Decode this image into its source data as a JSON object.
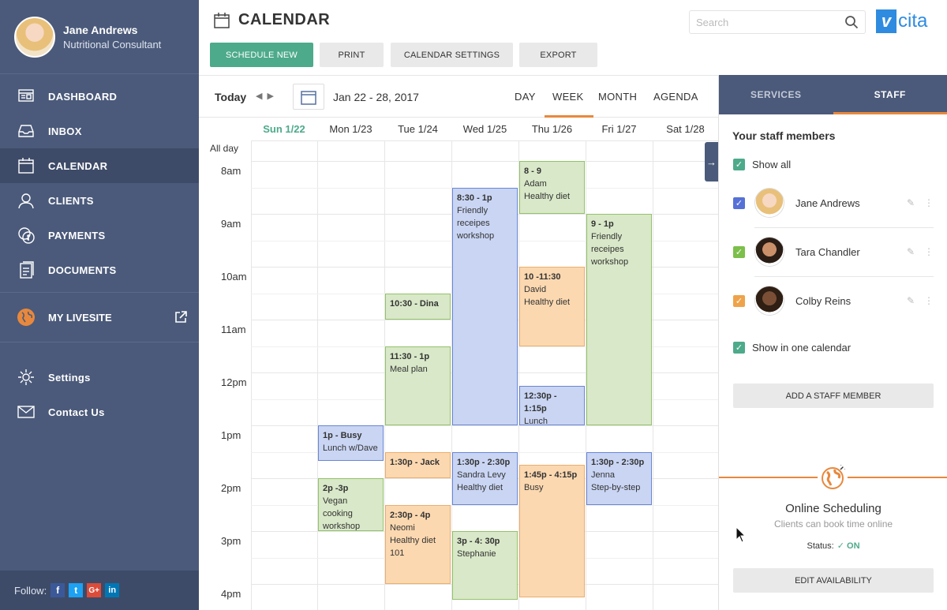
{
  "profile": {
    "name": "Jane Andrews",
    "role": "Nutritional Consultant"
  },
  "nav": [
    {
      "label": "DASHBOARD",
      "icon": "dashboard-icon"
    },
    {
      "label": "INBOX",
      "icon": "inbox-icon"
    },
    {
      "label": "CALENDAR",
      "icon": "calendar-icon",
      "active": true
    },
    {
      "label": "CLIENTS",
      "icon": "clients-icon"
    },
    {
      "label": "PAYMENTS",
      "icon": "payments-icon"
    },
    {
      "label": "DOCUMENTS",
      "icon": "documents-icon"
    }
  ],
  "livesite": {
    "label": "MY LIVESITE"
  },
  "nav_bottom": [
    {
      "label": "Settings",
      "icon": "gear-icon"
    },
    {
      "label": "Contact Us",
      "icon": "envelope-icon"
    }
  ],
  "follow": {
    "label": "Follow:",
    "networks": [
      "f",
      "t",
      "G+",
      "in"
    ]
  },
  "header": {
    "title": "CALENDAR",
    "buttons": {
      "schedule_new": "SCHEDULE NEW",
      "print": "PRINT",
      "calendar_settings": "CALENDAR SETTINGS",
      "export": "EXPORT"
    },
    "search_placeholder": "Search",
    "logo_text": "cita",
    "logo_mark": "v"
  },
  "toolbar": {
    "today": "Today",
    "range": "Jan 22 - 28, 2017",
    "views": {
      "day": "DAY",
      "week": "WEEK",
      "month": "MONTH",
      "agenda": "AGENDA"
    },
    "active_view": "WEEK"
  },
  "calendar": {
    "days": [
      "Sun 1/22",
      "Mon 1/23",
      "Tue 1/24",
      "Wed 1/25",
      "Thu 1/26",
      "Fri 1/27",
      "Sat 1/28"
    ],
    "today_index": 0,
    "all_day_label": "All day",
    "hours": [
      "8am",
      "9am",
      "10am",
      "11am",
      "12pm",
      "1pm",
      "2pm",
      "3pm",
      "4pm"
    ],
    "events": [
      {
        "day": 1,
        "start": 13.0,
        "end": 13.67,
        "title": "1p - Busy",
        "lines": [
          "Lunch w/Dave"
        ],
        "color": "blue"
      },
      {
        "day": 1,
        "start": 14.0,
        "end": 15.0,
        "title": "2p -3p",
        "lines": [
          "Vegan cooking",
          "workshop"
        ],
        "color": "green"
      },
      {
        "day": 2,
        "start": 10.5,
        "end": 11.0,
        "title": "10:30 - Dina",
        "lines": [],
        "color": "green"
      },
      {
        "day": 2,
        "start": 11.5,
        "end": 13.0,
        "title": "11:30 - 1p",
        "lines": [
          "Meal plan"
        ],
        "color": "green"
      },
      {
        "day": 2,
        "start": 13.5,
        "end": 14.0,
        "title": "1:30p - Jack",
        "lines": [],
        "color": "orange"
      },
      {
        "day": 2,
        "start": 14.5,
        "end": 16.0,
        "title": "2:30p - 4p",
        "lines": [
          "Neomi",
          "Healthy diet",
          "101"
        ],
        "color": "orange"
      },
      {
        "day": 3,
        "start": 8.5,
        "end": 13.0,
        "title": "8:30 - 1p",
        "lines": [
          "Friendly",
          "receipes",
          "workshop"
        ],
        "color": "blue"
      },
      {
        "day": 3,
        "start": 13.5,
        "end": 14.5,
        "title": "1:30p - 2:30p",
        "lines": [
          "Sandra Levy",
          "Healthy diet"
        ],
        "color": "blue"
      },
      {
        "day": 3,
        "start": 15.0,
        "end": 16.3,
        "title": "3p - 4: 30p",
        "lines": [
          "Stephanie"
        ],
        "color": "green"
      },
      {
        "day": 4,
        "start": 8.0,
        "end": 9.0,
        "title": "8 - 9",
        "lines": [
          "Adam",
          "Healthy diet"
        ],
        "color": "green"
      },
      {
        "day": 4,
        "start": 10.0,
        "end": 11.5,
        "title": "10 -11:30",
        "lines": [
          "David",
          "Healthy diet"
        ],
        "color": "orange"
      },
      {
        "day": 4,
        "start": 12.25,
        "end": 13.0,
        "title": "12:30p - 1:15p",
        "lines": [
          "Lunch"
        ],
        "color": "blue"
      },
      {
        "day": 4,
        "start": 13.75,
        "end": 16.25,
        "title": "1:45p - 4:15p",
        "lines": [
          "Busy"
        ],
        "color": "orange"
      },
      {
        "day": 5,
        "start": 9.0,
        "end": 13.0,
        "title": "9 - 1p",
        "lines": [
          "Friendly",
          "receipes",
          "workshop"
        ],
        "color": "green"
      },
      {
        "day": 5,
        "start": 13.5,
        "end": 14.5,
        "title": "1:30p - 2:30p",
        "lines": [
          "Jenna",
          "Step-by-step"
        ],
        "color": "blue"
      }
    ],
    "colors": {
      "green": "#93c26b",
      "blue": "#6a86d4",
      "orange": "#ecae6e"
    }
  },
  "panel": {
    "tabs": {
      "services": "SERVICES",
      "staff": "STAFF"
    },
    "active_tab": "STAFF",
    "title": "Your staff members",
    "show_all": "Show all",
    "staff": [
      {
        "name": "Jane Andrews",
        "color": "#5671d6"
      },
      {
        "name": "Tara Chandler",
        "color": "#7cbf4a"
      },
      {
        "name": "Colby Reins",
        "color": "#eea34a"
      }
    ],
    "show_in_one": "Show in one calendar",
    "add_staff": "ADD A STAFF MEMBER",
    "online_title": "Online Scheduling",
    "online_sub": "Clients can book time online",
    "status_label": "Status:",
    "status_value": "ON",
    "edit_availability": "EDIT AVAILABILITY"
  }
}
